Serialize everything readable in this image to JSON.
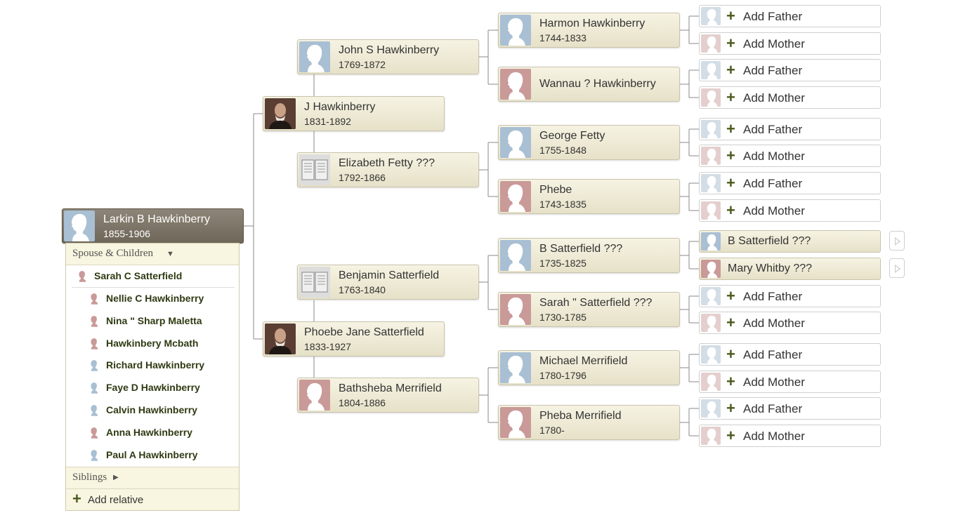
{
  "colors": {
    "male": "#a9bfd3",
    "female": "#c99a98",
    "card_bg": "#efebd6",
    "root_bg": "#7d7567",
    "plus": "#4a5a1c"
  },
  "root": {
    "name": "Larkin B Hawkinberry",
    "dates": "1855-1906"
  },
  "parents": [
    {
      "name": "J Hawkinberry",
      "dates": "1831-1892",
      "photo": "portrait-photo"
    },
    {
      "name": "Phoebe Jane Satterfield",
      "dates": "1833-1927",
      "photo": "portrait-photo"
    }
  ],
  "grandparents": [
    {
      "name": "John S Hawkinberry",
      "dates": "1769-1872",
      "gender": "male"
    },
    {
      "name": "Elizabeth Fetty ???",
      "dates": "1792-1866",
      "photo": "document-photo"
    },
    {
      "name": "Benjamin Satterfield",
      "dates": "1763-1840",
      "photo": "document-photo"
    },
    {
      "name": "Bathsheba Merrifield",
      "dates": "1804-1886",
      "gender": "female"
    }
  ],
  "great_grandparents": [
    {
      "name": "Harmon Hawkinberry",
      "dates": "1744-1833",
      "gender": "male"
    },
    {
      "name": "Wannau ? Hawkinberry",
      "dates": "",
      "gender": "female"
    },
    {
      "name": "George Fetty",
      "dates": "1755-1848",
      "gender": "male"
    },
    {
      "name": "Phebe",
      "dates": "1743-1835",
      "gender": "female"
    },
    {
      "name": "B Satterfield ???",
      "dates": "1735-1825",
      "gender": "male"
    },
    {
      "name": "Sarah \" Satterfield ???",
      "dates": "1730-1785",
      "gender": "female"
    },
    {
      "name": "Michael Merrifield",
      "dates": "1780-1796",
      "gender": "male"
    },
    {
      "name": "Pheba Merrifield",
      "dates": "1780-",
      "gender": "female"
    }
  ],
  "add_labels": {
    "father": "Add Father",
    "mother": "Add Mother"
  },
  "known_ancestors": [
    {
      "name": "B Satterfield ???",
      "gender": "male"
    },
    {
      "name": "Mary Whitby ???",
      "gender": "female"
    }
  ],
  "panel": {
    "header": "Spouse & Children",
    "spouse": {
      "name": "Sarah C Satterfield",
      "gender": "female"
    },
    "children": [
      {
        "name": "Nellie C Hawkinberry",
        "gender": "female"
      },
      {
        "name": "Nina \" Sharp Maletta",
        "gender": "female"
      },
      {
        "name": "Hawkinbery Mcbath",
        "gender": "female"
      },
      {
        "name": "Richard Hawkinberry",
        "gender": "male"
      },
      {
        "name": "Faye D Hawkinberry",
        "gender": "male"
      },
      {
        "name": "Calvin Hawkinberry",
        "gender": "male"
      },
      {
        "name": "Anna Hawkinberry",
        "gender": "female"
      },
      {
        "name": "Paul A Hawkinberry",
        "gender": "male"
      }
    ],
    "siblings": "Siblings",
    "add_relative": "Add relative"
  }
}
